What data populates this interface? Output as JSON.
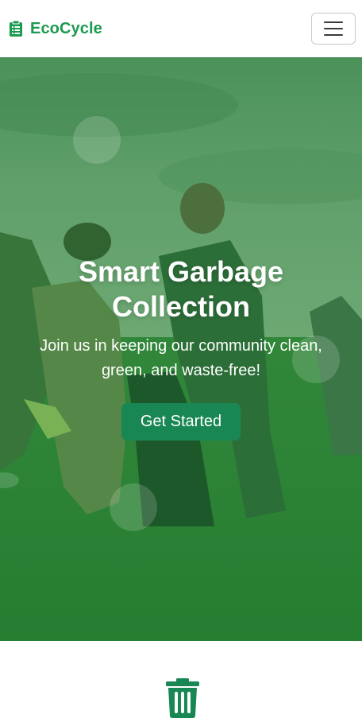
{
  "navbar": {
    "brand": "EcoCycle",
    "brand_icon": "clipboard-icon",
    "menu_icon": "hamburger-menu-icon"
  },
  "hero": {
    "title": "Smart Garbage Collection",
    "subtitle": "Join us in keeping our community clean, green, and waste-free!",
    "cta_label": "Get Started"
  },
  "feature": {
    "icon": "trash-icon"
  },
  "colors": {
    "brand": "#1c9a4f",
    "cta": "#198754",
    "overlay": "#1e8237"
  }
}
